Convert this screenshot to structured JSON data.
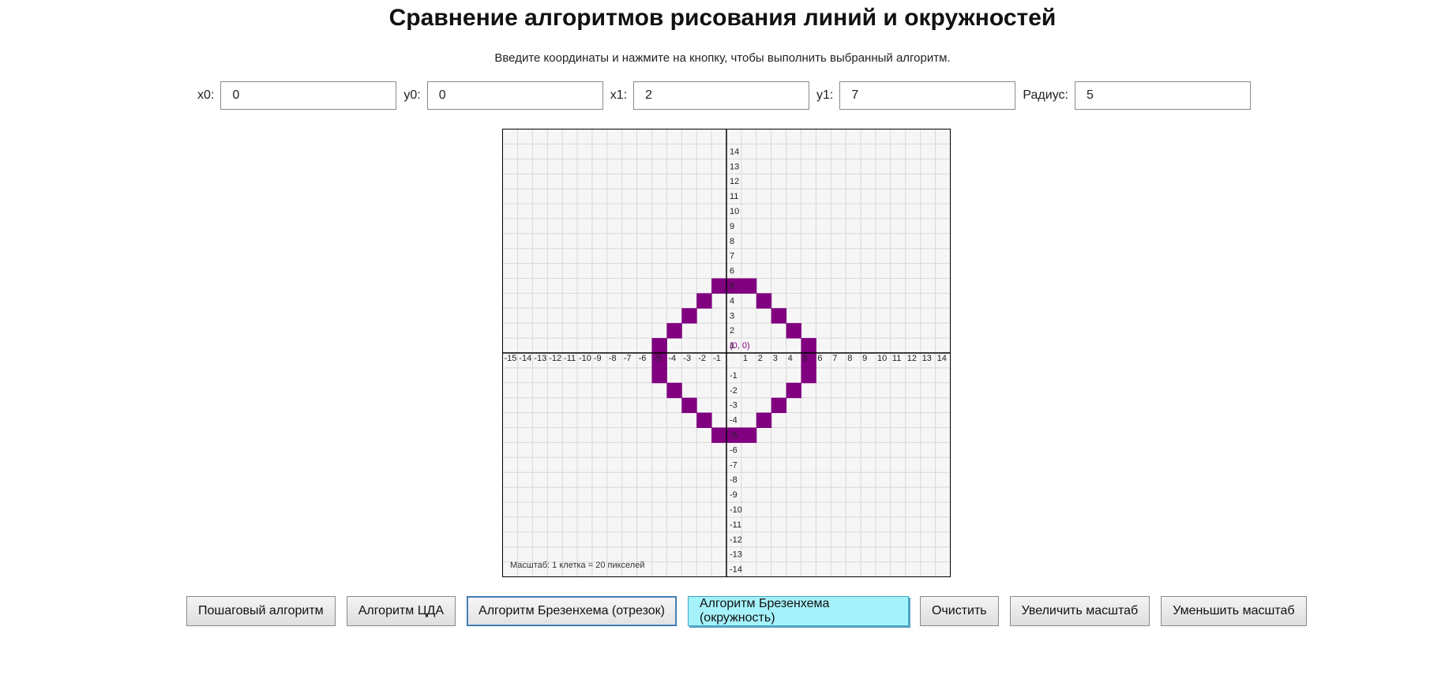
{
  "page": {
    "title": "Сравнение алгоритмов рисования линий и окружностей",
    "subtitle": "Введите координаты и нажмите на кнопку, чтобы выполнить выбранный алгоритм."
  },
  "inputs": {
    "x0": {
      "label": "x0:",
      "value": "0"
    },
    "y0": {
      "label": "y0:",
      "value": "0"
    },
    "x1": {
      "label": "x1:",
      "value": "2"
    },
    "y1": {
      "label": "y1:",
      "value": "7"
    },
    "radius": {
      "label": "Радиус:",
      "value": "5"
    }
  },
  "canvas": {
    "grid_range": [
      -15,
      14
    ],
    "origin_label": "(0, 0)",
    "scale_caption": "Масштаб: 1 клетка = 20 пикселей",
    "colors": {
      "pixel": "#800080",
      "axis": "#000000",
      "grid": "#d8d8d8",
      "background": "#f6f6f6",
      "origin": "#800080"
    },
    "circle_pixels": [
      [
        -1,
        5
      ],
      [
        0,
        5
      ],
      [
        1,
        5
      ],
      [
        -2,
        4
      ],
      [
        2,
        4
      ],
      [
        -3,
        3
      ],
      [
        3,
        3
      ],
      [
        -4,
        2
      ],
      [
        4,
        2
      ],
      [
        -5,
        1
      ],
      [
        5,
        1
      ],
      [
        -5,
        0
      ],
      [
        5,
        0
      ],
      [
        -5,
        -1
      ],
      [
        5,
        -1
      ],
      [
        -4,
        -2
      ],
      [
        4,
        -2
      ],
      [
        -3,
        -3
      ],
      [
        3,
        -3
      ],
      [
        -2,
        -4
      ],
      [
        2,
        -4
      ],
      [
        -1,
        -5
      ],
      [
        0,
        -5
      ],
      [
        1,
        -5
      ]
    ]
  },
  "buttons": [
    {
      "id": "step",
      "label": "Пошаговый алгоритм"
    },
    {
      "id": "dda",
      "label": "Алгоритм ЦДА"
    },
    {
      "id": "bres-line",
      "label": "Алгоритм Брезенхема (отрезок)",
      "state": "focused"
    },
    {
      "id": "bres-circle",
      "label": "Алгоритм Брезенхема (окружность)",
      "state": "active"
    },
    {
      "id": "clear",
      "label": "Очистить"
    },
    {
      "id": "zoom-in",
      "label": "Увеличить масштаб"
    },
    {
      "id": "zoom-out",
      "label": "Уменьшить масштаб"
    }
  ]
}
